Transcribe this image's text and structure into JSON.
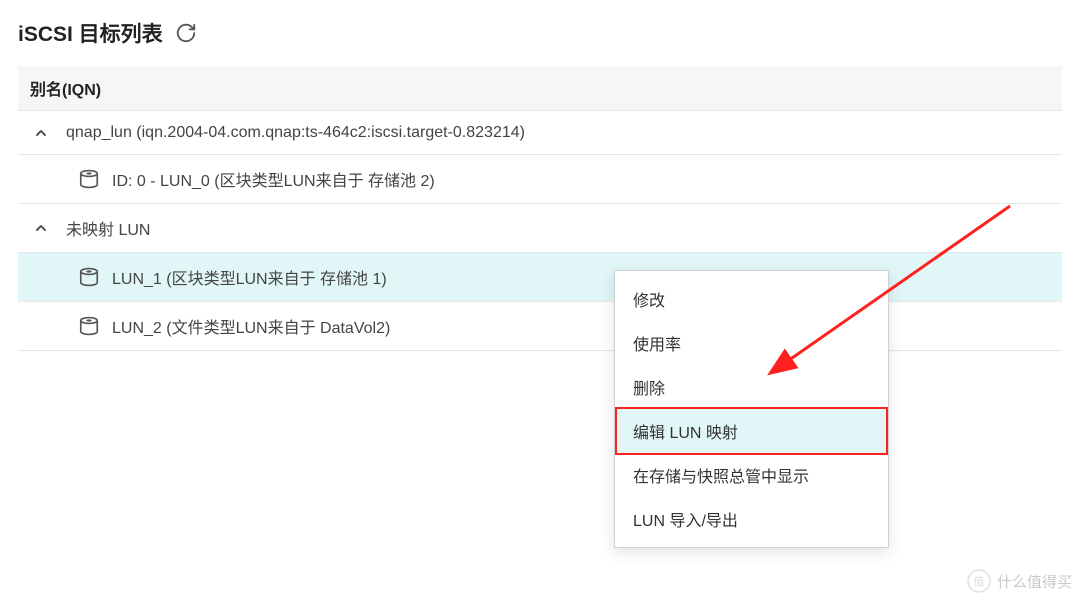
{
  "header": {
    "title": "iSCSI 目标列表"
  },
  "columns": {
    "alias": "别名(IQN)"
  },
  "targets": [
    {
      "label": "qnap_lun (iqn.2004-04.com.qnap:ts-464c2:iscsi.target-0.823214)",
      "luns": [
        {
          "label": "ID: 0 - LUN_0 (区块类型LUN来自于 存储池 2)"
        }
      ]
    },
    {
      "label": "未映射 LUN",
      "luns": [
        {
          "label": "LUN_1 (区块类型LUN来自于 存储池 1)",
          "highlighted": true
        },
        {
          "label": "LUN_2 (文件类型LUN来自于 DataVol2)"
        }
      ]
    }
  ],
  "context_menu": {
    "items": [
      {
        "label": "修改"
      },
      {
        "label": "使用率"
      },
      {
        "label": "删除"
      },
      {
        "label": "编辑 LUN 映射",
        "highlighted": true,
        "boxed": true
      },
      {
        "label": "在存储与快照总管中显示"
      },
      {
        "label": "LUN 导入/导出"
      }
    ]
  },
  "annotation": {
    "arrow_color": "#ff2020"
  },
  "watermark": {
    "text": "什么值得买"
  }
}
